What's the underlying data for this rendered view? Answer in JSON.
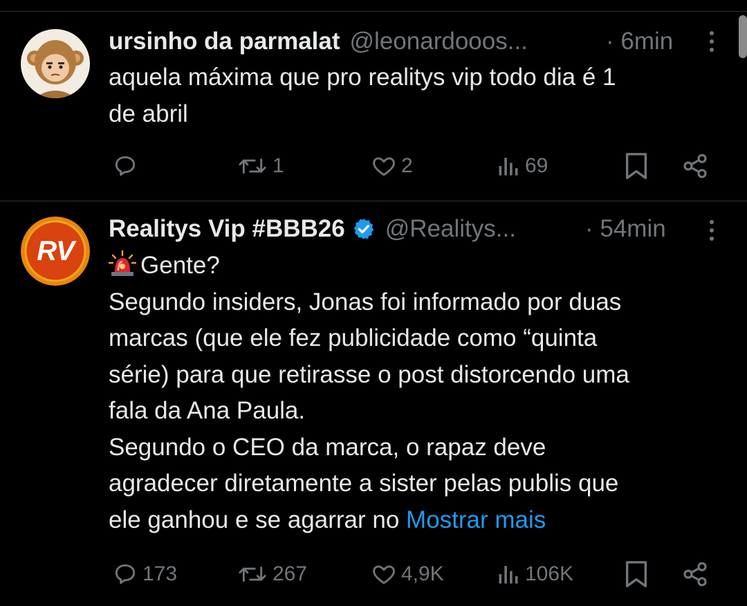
{
  "colors": {
    "background": "#000000",
    "text": "#e7e9ea",
    "muted": "#71767b",
    "link": "#1d9bf0",
    "verified": "#1d9bf0",
    "divider": "#2f3336"
  },
  "tweets": [
    {
      "display_name": "ursinho da parmalat",
      "handle": "@leonardooos...",
      "time": "· 6min",
      "avatar_icon": "monkey-costume-avatar",
      "body_lines": [
        "aquela máxima que pro realitys vip todo dia é 1",
        "de abril"
      ],
      "stats": {
        "replies": "",
        "retweets": "1",
        "likes": "2",
        "views": "69"
      }
    },
    {
      "display_name": "Realitys Vip #BBB26",
      "verified": true,
      "handle": "@Realitys...",
      "time": "· 54min",
      "avatar_text": "RV",
      "body_lines": [
        "Gente?",
        "Segundo insiders, Jonas foi informado por duas",
        "marcas (que ele fez publicidade como “quinta",
        "série) para que retirasse o post distorcendo uma",
        "fala da Ana Paula.",
        "Segundo o CEO da marca, o rapaz deve",
        "agradecer diretamente a sister pelas publis que",
        "ele ganhou e se agarrar no"
      ],
      "show_more": "Mostrar mais",
      "stats": {
        "replies": "173",
        "retweets": "267",
        "likes": "4,9K",
        "views": "106K"
      }
    }
  ]
}
